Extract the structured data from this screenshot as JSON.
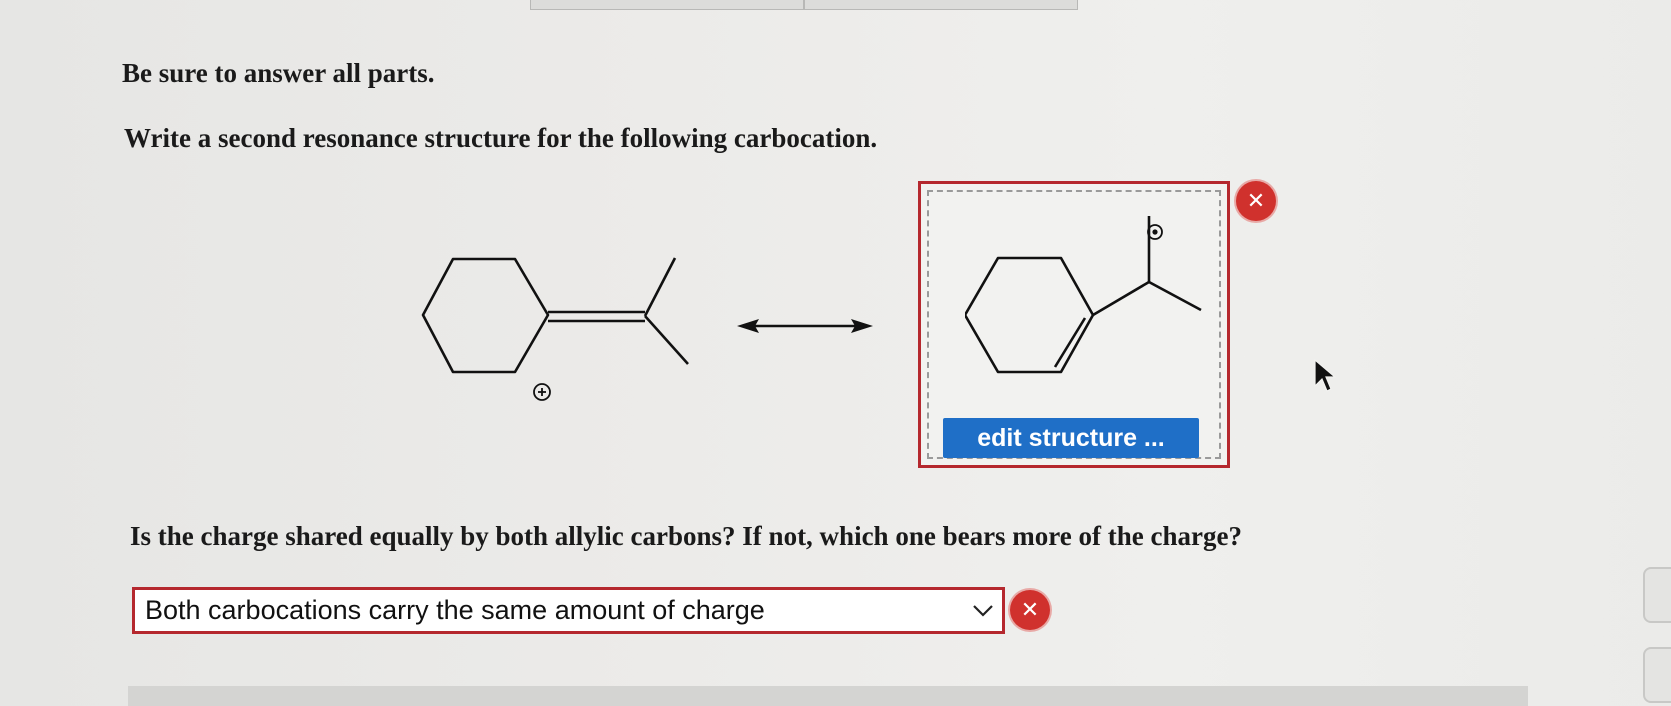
{
  "instructions": {
    "line1": "Be sure to answer all parts.",
    "line2": "Write a second resonance structure for the following carbocation.",
    "question2": "Is the charge shared equally by both allylic carbons? If not, which one bears more of the charge?"
  },
  "structure_editor": {
    "edit_label": "edit structure ...",
    "status": "incorrect"
  },
  "charge_select": {
    "selected": "Both carbocations carry the same amount of charge",
    "status": "incorrect"
  },
  "icons": {
    "error": "close-x-icon",
    "resonance_arrow": "double-headed-arrow-icon",
    "dropdown": "chevron-down-icon",
    "cursor": "mouse-pointer-icon"
  },
  "colors": {
    "error_red": "#d0312d",
    "border_red": "#b5282e",
    "button_blue": "#1f6fc7"
  }
}
